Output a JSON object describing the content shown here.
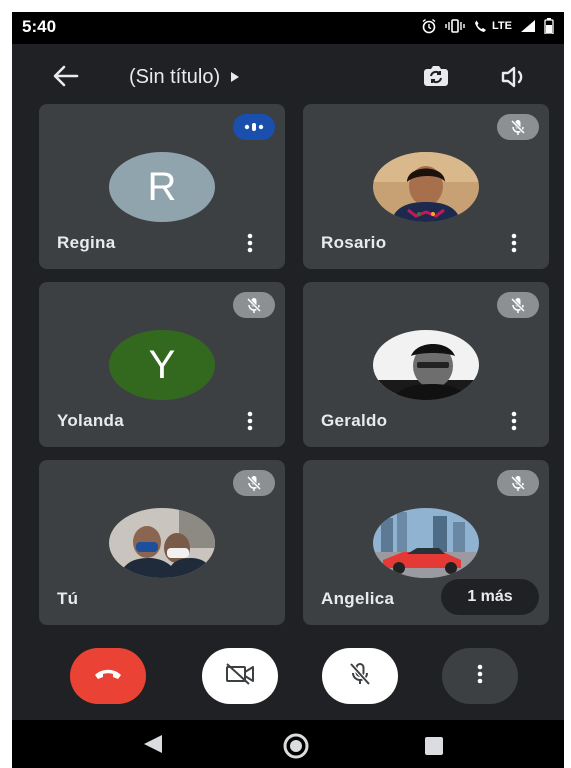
{
  "status_bar": {
    "time": "5:40",
    "network": "LTE"
  },
  "meeting": {
    "title": "(Sin título)"
  },
  "participants": [
    {
      "name": "Regina",
      "initial": "R",
      "avatar_color": "#90a4ae",
      "speaking": true
    },
    {
      "name": "Rosario",
      "photo": true,
      "muted": true
    },
    {
      "name": "Yolanda",
      "initial": "Y",
      "avatar_color": "#33691e",
      "muted": true
    },
    {
      "name": "Geraldo",
      "photo": true,
      "muted": true
    },
    {
      "name": "Tú",
      "photo": true,
      "muted": true
    },
    {
      "name": "Angelica",
      "photo": true,
      "muted": true,
      "extra_label": "1 más"
    }
  ],
  "colors": {
    "background": "#202124",
    "tile": "#3c4043",
    "end_call": "#ea4335",
    "speaking": "#1a4fae"
  },
  "icons": [
    "back-arrow-icon",
    "play-arrow-icon",
    "switch-camera-icon",
    "speaker-icon",
    "mic-off-icon",
    "more-vert-icon",
    "end-call-icon",
    "camera-off-icon"
  ]
}
